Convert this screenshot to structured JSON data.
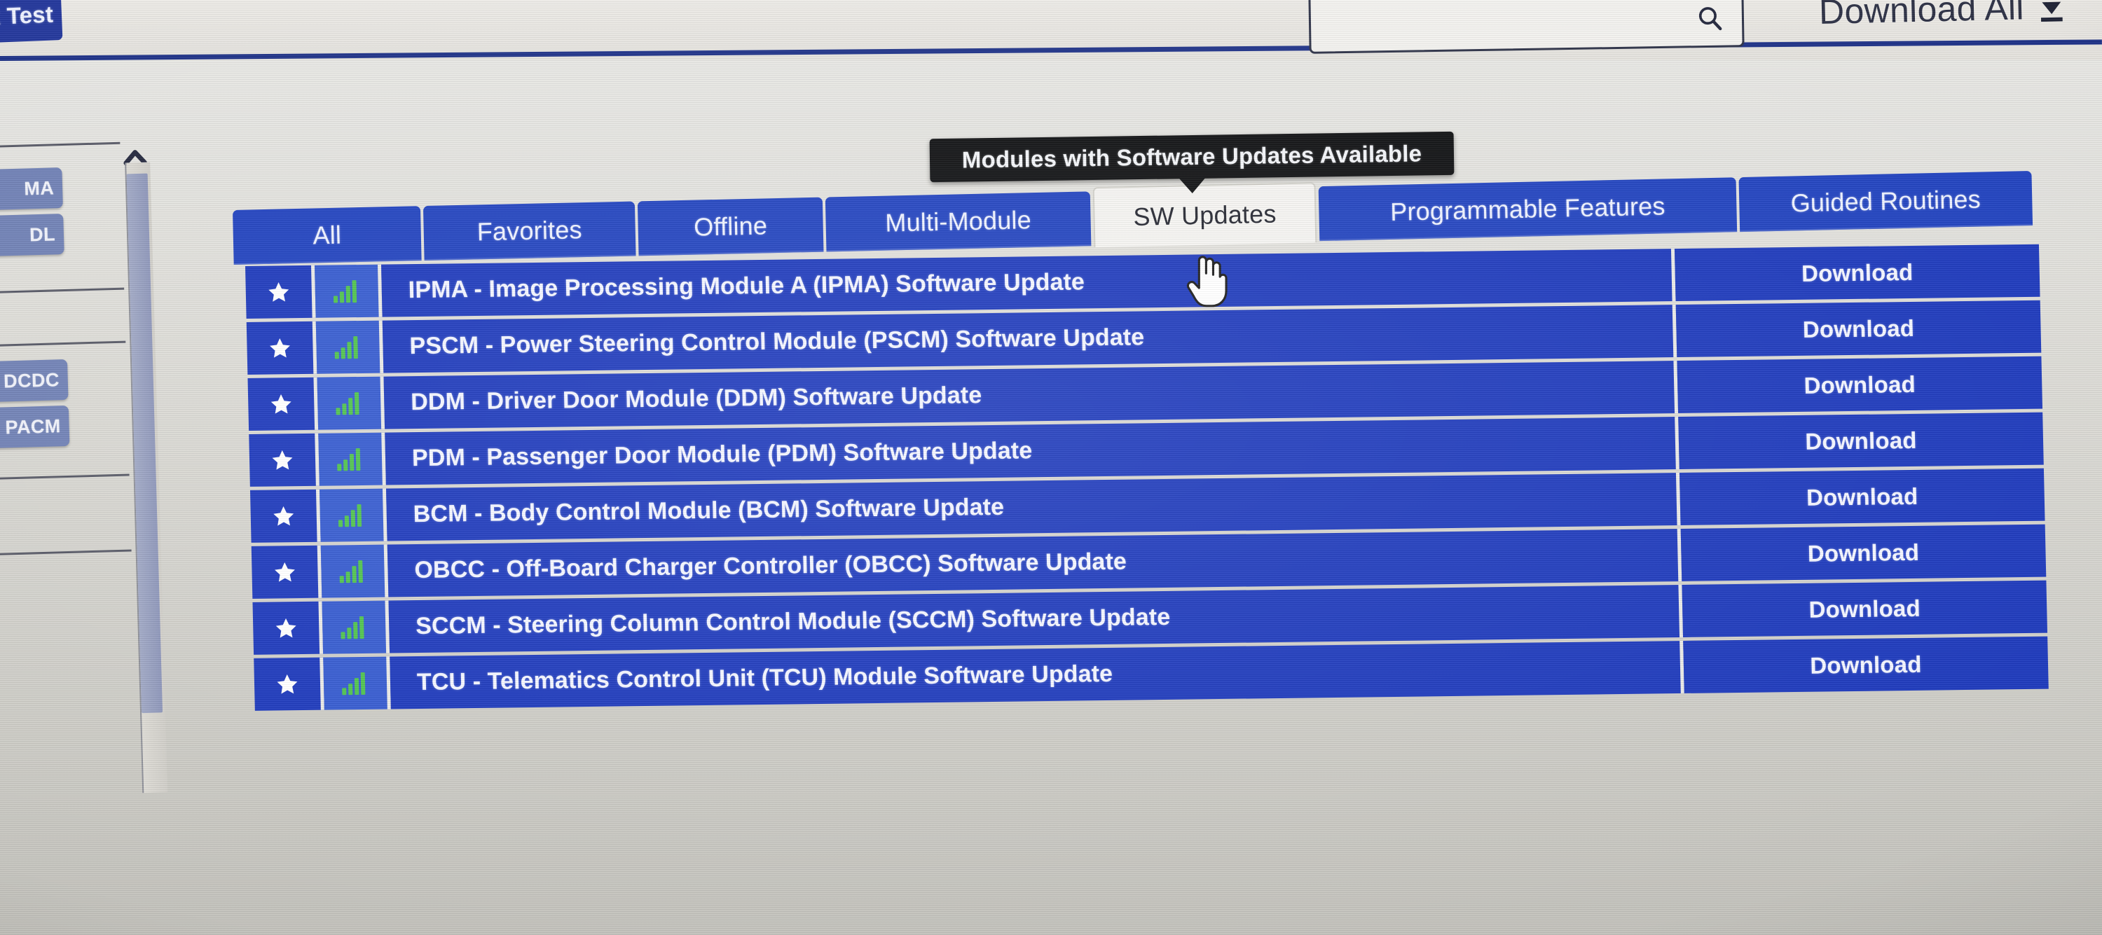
{
  "header": {
    "breadcrumb_tab": "rk Test",
    "search_placeholder": "",
    "search_value": "",
    "search_icon": "search-icon",
    "download_all_label": "Download All",
    "download_all_icon": "download-arrow-icon"
  },
  "tooltip": {
    "text": "Modules with Software Updates Available"
  },
  "tabs": [
    {
      "label": "All",
      "active": false
    },
    {
      "label": "Favorites",
      "active": false
    },
    {
      "label": "Offline",
      "active": false
    },
    {
      "label": "Multi-Module",
      "active": false
    },
    {
      "label": "SW Updates",
      "active": true
    },
    {
      "label": "Programmable Features",
      "active": false
    },
    {
      "label": "Guided Routines",
      "active": false
    }
  ],
  "sidebar": {
    "chips": [
      "MA",
      "DL",
      "DCDC",
      "PACM"
    ],
    "collapse_icon": "chevron-up-icon",
    "scrollbar": "vertical-scrollbar"
  },
  "table": {
    "favorite_icon": "star-icon",
    "signal_icon": "signal-bars-icon",
    "action_label": "Download",
    "rows": [
      {
        "name": "IPMA - Image Processing Module A (IPMA) Software Update",
        "action": "Download"
      },
      {
        "name": "PSCM - Power Steering Control Module (PSCM) Software Update",
        "action": "Download"
      },
      {
        "name": "DDM - Driver Door Module (DDM) Software Update",
        "action": "Download"
      },
      {
        "name": "PDM - Passenger Door Module (PDM) Software Update",
        "action": "Download"
      },
      {
        "name": "BCM - Body Control Module (BCM) Software Update",
        "action": "Download"
      },
      {
        "name": "OBCC - Off-Board Charger Controller (OBCC) Software Update",
        "action": "Download"
      },
      {
        "name": "SCCM - Steering Column Control Module (SCCM) Software Update",
        "action": "Download"
      },
      {
        "name": "TCU - Telematics Control Unit (TCU) Module Software Update",
        "action": "Download"
      }
    ]
  },
  "cursor": {
    "type": "pointing-hand"
  },
  "colors": {
    "row_blue": "#1936bb",
    "signal_cell_blue": "#3258cf",
    "tab_blue": "#1d3fbe",
    "nav_tab_blue": "#21359a",
    "signal_green": "#4cc24a",
    "tooltip_bg": "#0b0c0e",
    "page_bg": "#c9c8c2"
  }
}
